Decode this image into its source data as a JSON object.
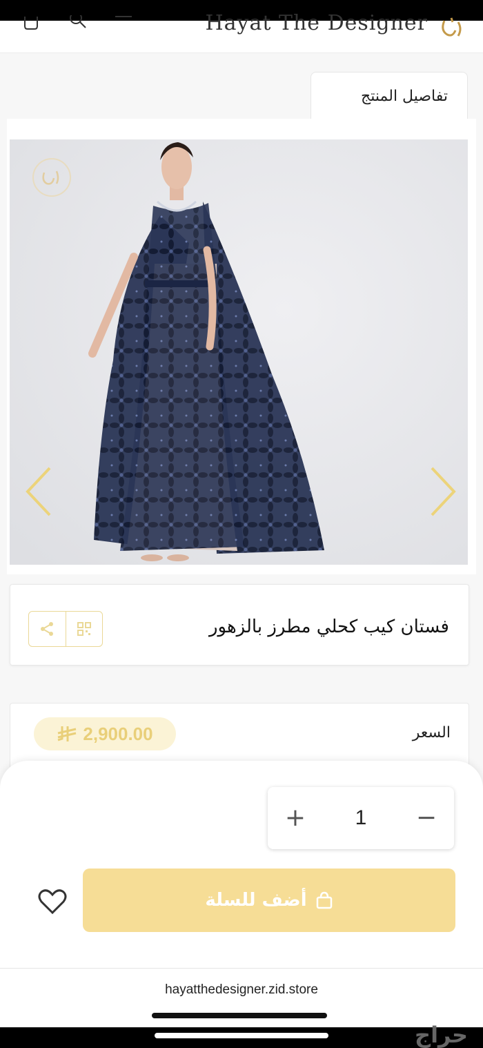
{
  "header": {
    "brand": "Hayat The Designer"
  },
  "tabs": {
    "product_details": "تفاصيل المنتج"
  },
  "gallery": {
    "progress": 0.8
  },
  "product": {
    "title": "فستان كيب كحلي مطرز بالزهور",
    "price_label": "السعر",
    "price": "2,900.00"
  },
  "cart": {
    "quantity": "1",
    "plus": "+",
    "minus": "−",
    "add_to_cart": "أضف للسلة"
  },
  "browser": {
    "url": "hayatthedesigner.zid.store"
  },
  "watermark": {
    "text": "حراج"
  },
  "colors": {
    "accent": "#f6dd96",
    "gold": "#e9cf79",
    "dress": "#1b2544"
  }
}
